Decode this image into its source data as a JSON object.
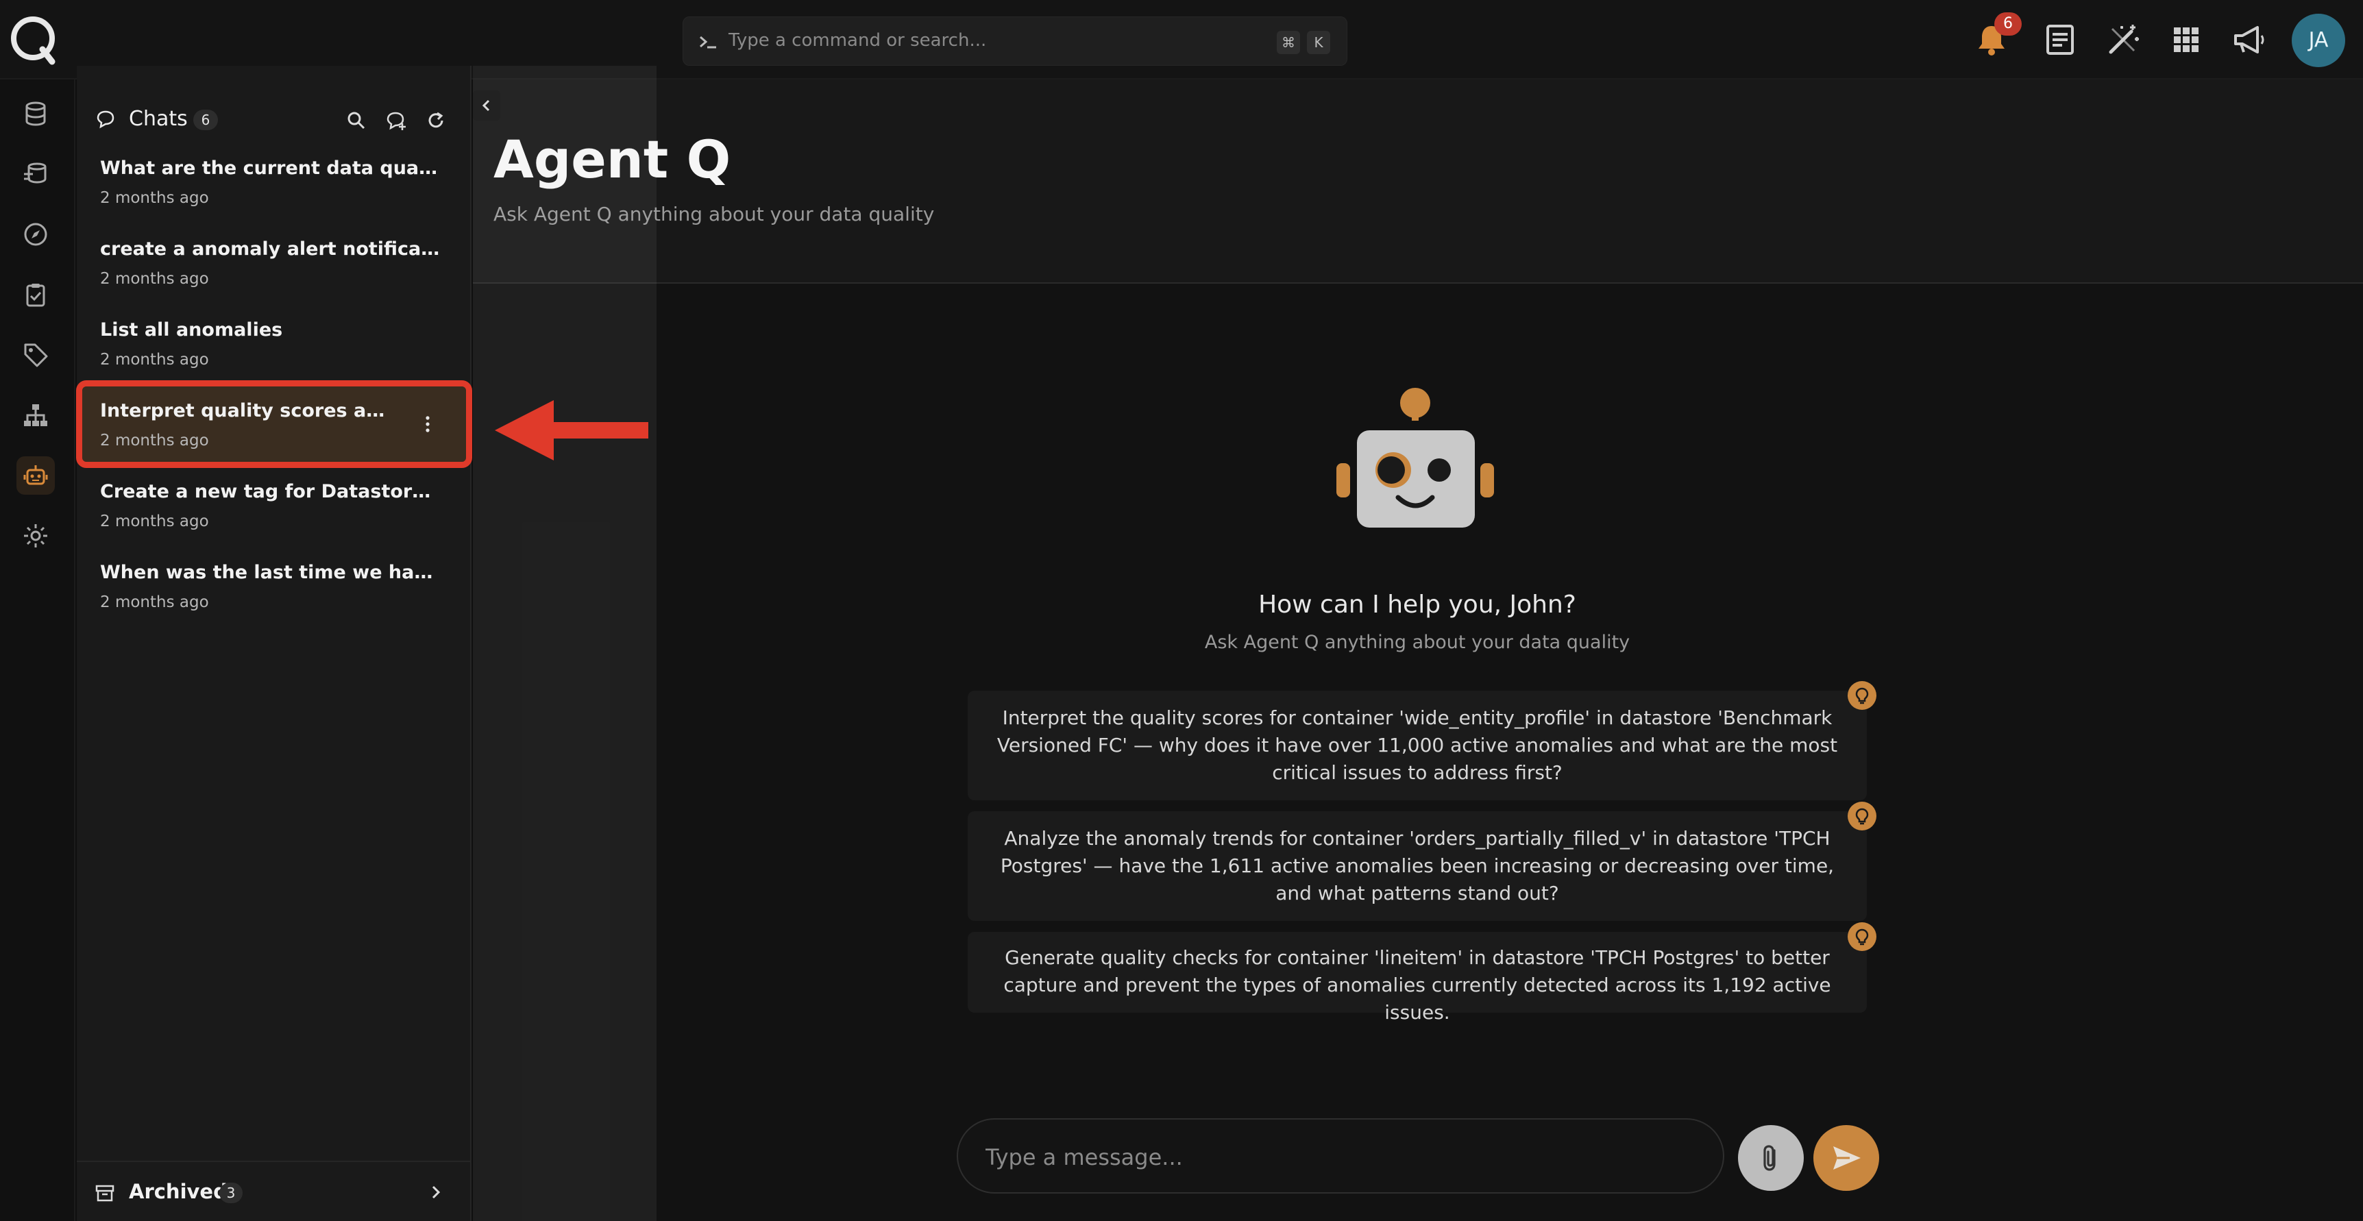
{
  "search": {
    "placeholder": "Type a command or search...",
    "shortcut_mod": "⌘",
    "shortcut_key": "K"
  },
  "header": {
    "notification_count": "6",
    "avatar_initials": "JA"
  },
  "chats": {
    "title": "Chats",
    "count": "6",
    "items": [
      {
        "title": "What are the current data quality s...",
        "time": "2 months ago"
      },
      {
        "title": "create a anomaly alert notification ...",
        "time": "2 months ago"
      },
      {
        "title": "List all anomalies",
        "time": "2 months ago"
      },
      {
        "title": "Interpret quality scores and top...",
        "time": "2 months ago"
      },
      {
        "title": "Create a new tag for Datastore: An...",
        "time": "2 months ago"
      },
      {
        "title": "When was the last time we have an ...",
        "time": "2 months ago"
      }
    ],
    "archived_label": "Archived",
    "archived_count": "3"
  },
  "main": {
    "title": "Agent Q",
    "subtitle": "Ask Agent Q anything about your data quality",
    "greeting": "How can I help you, John?",
    "greeting_sub": "Ask Agent Q anything about your data quality",
    "suggestions": [
      "Interpret the quality scores for container 'wide_entity_profile' in datastore 'Benchmark Versioned FC' — why does it have over 11,000 active anomalies and what are the most critical issues to address first?",
      "Analyze the anomaly trends for container 'orders_partially_filled_v' in datastore 'TPCH Postgres' — have the 1,611 active anomalies been increasing or decreasing over time, and what patterns stand out?",
      "Generate quality checks for container 'lineitem' in datastore 'TPCH Postgres' to better capture and prevent the types of anomalies currently detected across its 1,192 active issues."
    ],
    "message_placeholder": "Type a message..."
  },
  "colors": {
    "accent": "#c9873f",
    "highlight": "#e03a2a",
    "avatar": "#2c6f85"
  }
}
